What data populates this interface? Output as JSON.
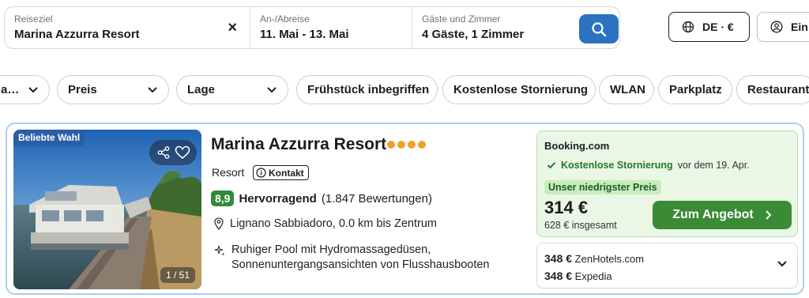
{
  "search": {
    "destination_label": "Reiseziel",
    "destination_value": "Marina Azzurra Resort",
    "dates_label": "An-/Abreise",
    "dates_value": "11. Mai - 13. Mai",
    "guests_label": "Gäste und Zimmer",
    "guests_value": "4 Gäste, 1 Zimmer",
    "clear_icon": "×"
  },
  "header": {
    "language_label": "DE · €",
    "login_label": "Ein"
  },
  "filters": [
    {
      "label": "a…"
    },
    {
      "label": "Preis"
    },
    {
      "label": "Lage"
    },
    {
      "label": "Frühstück inbegriffen"
    },
    {
      "label": "Kostenlose Stornierung"
    },
    {
      "label": "WLAN"
    },
    {
      "label": "Parkplatz"
    },
    {
      "label": "Restaurant"
    }
  ],
  "result": {
    "badge": "Beliebte Wahl",
    "photo_counter": "1 / 51",
    "name": "Marina Azzurra Resort",
    "stars": 4,
    "type": "Resort",
    "contact_label": "Kontakt",
    "score": "8,9",
    "rating_label": "Hervorragend",
    "reviews": "(1.847 Bewertungen)",
    "location": "Lignano Sabbiadoro, 0.0 km bis Zentrum",
    "highlight_line1": "Ruhiger Pool mit Hydromassagedüsen,",
    "highlight_line2": "Sonnenuntergangsansichten von Flusshausbooten",
    "deal": {
      "provider": "Booking.com",
      "cancel_text": "Kostenlose Stornierung",
      "cancel_date": "vor dem 19. Apr.",
      "lowest_label": "Unser niedrigster Preis",
      "price": "314 €",
      "total": "628 € insgesamt",
      "cta": "Zum Angebot"
    },
    "other_offers": [
      {
        "price": "348 €",
        "provider": "ZenHotels.com"
      },
      {
        "price": "348 €",
        "provider": "Expedia"
      }
    ]
  },
  "colors": {
    "accent_blue": "#2b73c2",
    "badge_blue": "#2a5ea8",
    "green_score": "#2f8a39",
    "cta_green": "#3a8a36",
    "deal_bg": "#eaf7e4",
    "star_orange": "#f0a030"
  }
}
